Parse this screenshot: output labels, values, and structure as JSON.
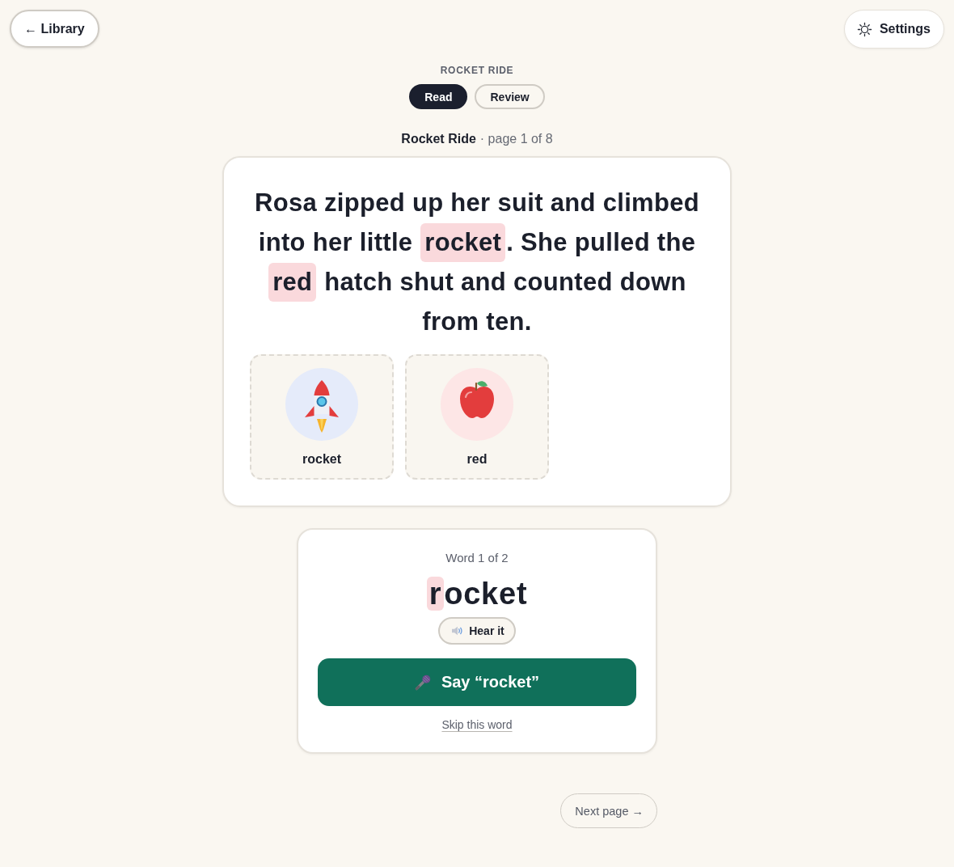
{
  "top_bar": {
    "back_label": "← Library",
    "settings_label": "Settings"
  },
  "header": {
    "eyebrow": "ROCKET RIDE",
    "tabs": [
      {
        "label": "Read",
        "selected": true
      },
      {
        "label": "Review",
        "selected": false
      }
    ],
    "book_title": "Rocket Ride",
    "page_label": "· page 1 of 8"
  },
  "story": {
    "segments": [
      {
        "text": "Rosa zipped up her suit and climbed into her little ",
        "highlighted": false
      },
      {
        "text": "rocket",
        "highlighted": true
      },
      {
        "text": ". She pulled the ",
        "highlighted": false
      },
      {
        "text": "red",
        "highlighted": true
      },
      {
        "text": " hatch shut and counted down from ten.",
        "highlighted": false
      }
    ],
    "word_cards": [
      {
        "kind": "rocket",
        "label": "rocket"
      },
      {
        "kind": "apple",
        "label": "red"
      }
    ]
  },
  "practice": {
    "counter": "Word 1 of 2",
    "word_segments": [
      {
        "text": "r",
        "highlighted": true
      },
      {
        "text": "ocket",
        "highlighted": false
      }
    ],
    "hear_button": "Hear it",
    "say_button": "Say “rocket”",
    "skip_link": "Skip this word"
  },
  "next_button": "Next page →"
}
